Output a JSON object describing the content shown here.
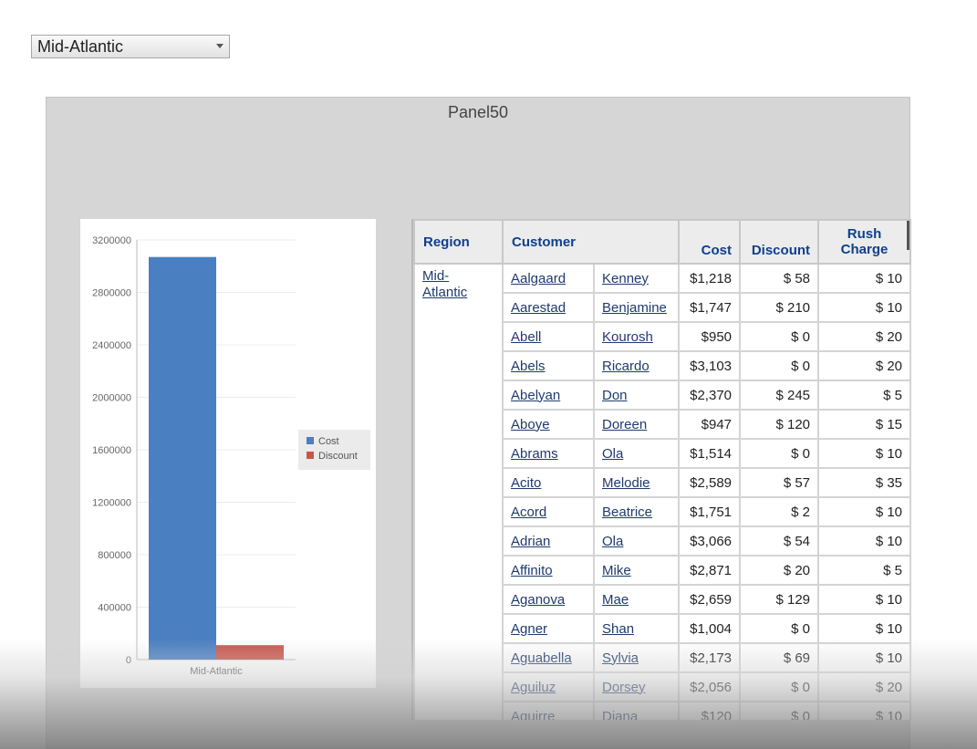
{
  "region_select": {
    "value": "Mid-Atlantic"
  },
  "panel": {
    "title": "Panel50"
  },
  "chart_data": {
    "type": "bar",
    "categories": [
      "Mid-Atlantic"
    ],
    "series": [
      {
        "name": "Cost",
        "values": [
          3070000
        ],
        "color": "#4a7fc1"
      },
      {
        "name": "Discount",
        "values": [
          110000
        ],
        "color": "#c9554a"
      }
    ],
    "yticks": [
      "0",
      "400000",
      "800000",
      "1200000",
      "1600000",
      "2000000",
      "2400000",
      "2800000",
      "3200000"
    ],
    "ylim": [
      0,
      3200000
    ],
    "grid": true,
    "legend": "right"
  },
  "table": {
    "headers": {
      "region": "Region",
      "customer": "Customer",
      "cost": "Cost",
      "discount": "Discount",
      "rush_line1": "Rush",
      "rush_line2": "Charge"
    },
    "region_value_line1": "Mid-",
    "region_value_line2": "Atlantic",
    "rows": [
      {
        "last": "Aalgaard",
        "first": "Kenney",
        "cost": "$1,218",
        "discount": "$  58",
        "rush": "$  10"
      },
      {
        "last": "Aarestad",
        "first": "Benjamine",
        "cost": "$1,747",
        "discount": "$  210",
        "rush": "$  10"
      },
      {
        "last": "Abell",
        "first": "Kourosh",
        "cost": "$950",
        "discount": "$  0",
        "rush": "$  20"
      },
      {
        "last": "Abels",
        "first": "Ricardo",
        "cost": "$3,103",
        "discount": "$  0",
        "rush": "$  20"
      },
      {
        "last": "Abelyan",
        "first": "Don",
        "cost": "$2,370",
        "discount": "$  245",
        "rush": "$  5"
      },
      {
        "last": "Aboye",
        "first": "Doreen",
        "cost": "$947",
        "discount": "$  120",
        "rush": "$  15"
      },
      {
        "last": "Abrams",
        "first": "Ola",
        "cost": "$1,514",
        "discount": "$  0",
        "rush": "$  10"
      },
      {
        "last": "Acito",
        "first": "Melodie",
        "cost": "$2,589",
        "discount": "$  57",
        "rush": "$  35"
      },
      {
        "last": "Acord",
        "first": "Beatrice",
        "cost": "$1,751",
        "discount": "$  2",
        "rush": "$  10"
      },
      {
        "last": "Adrian",
        "first": "Ola",
        "cost": "$3,066",
        "discount": "$  54",
        "rush": "$  10"
      },
      {
        "last": "Affinito",
        "first": "Mike",
        "cost": "$2,871",
        "discount": "$  20",
        "rush": "$  5"
      },
      {
        "last": "Aganova",
        "first": "Mae",
        "cost": "$2,659",
        "discount": "$  129",
        "rush": "$  10"
      },
      {
        "last": "Agner",
        "first": "Shan",
        "cost": "$1,004",
        "discount": "$  0",
        "rush": "$  10"
      },
      {
        "last": "Aguabella",
        "first": "Sylvia",
        "cost": "$2,173",
        "discount": "$  69",
        "rush": "$  10"
      },
      {
        "last": "Aguiluz",
        "first": "Dorsey",
        "cost": "$2,056",
        "discount": "$  0",
        "rush": "$  20"
      },
      {
        "last": "Aguirre",
        "first": "Diana",
        "cost": "$120",
        "discount": "$  0",
        "rush": "$  10"
      }
    ]
  }
}
